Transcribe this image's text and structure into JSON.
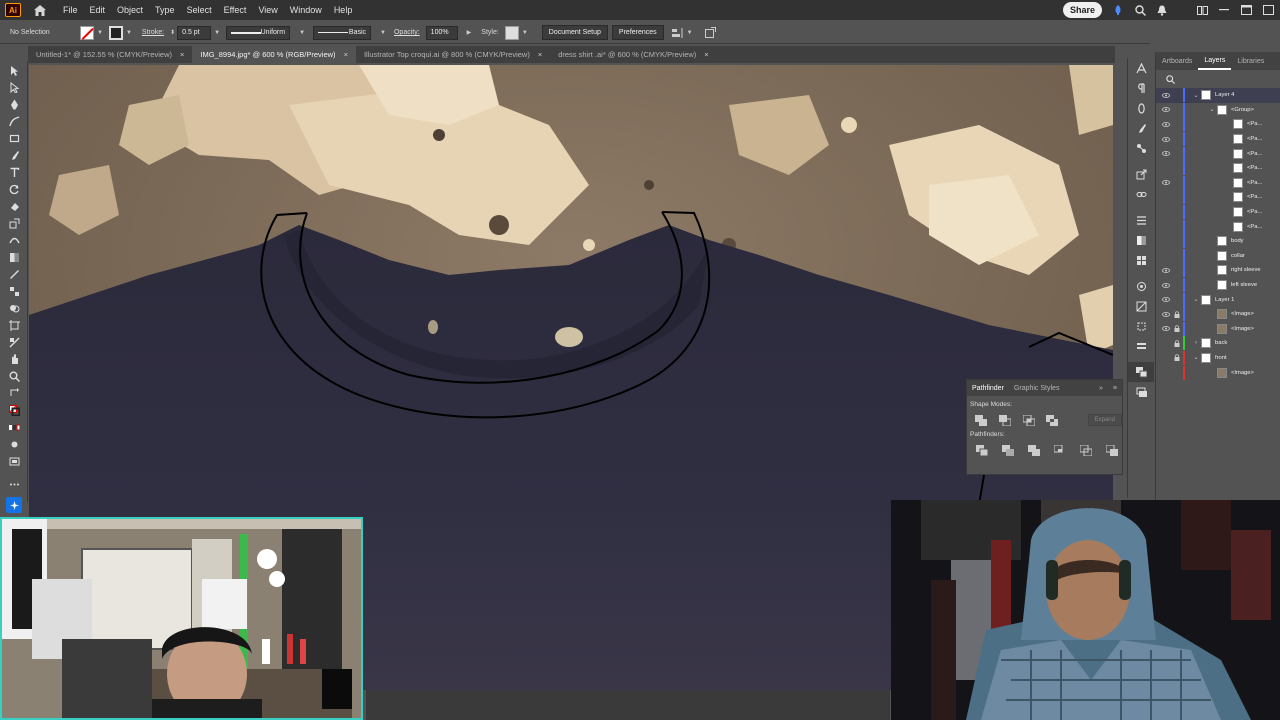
{
  "app": {
    "menus": [
      "File",
      "Edit",
      "Object",
      "Type",
      "Select",
      "Effect",
      "View",
      "Window",
      "Help"
    ],
    "share_label": "Share",
    "logo_text": "Ai"
  },
  "control_bar": {
    "selection": "No Selection",
    "stroke_label": "Stroke:",
    "stroke_value": "0.5 pt",
    "uniform_label": "Uniform",
    "basic_label": "Basic",
    "opacity_label": "Opacity:",
    "opacity_value": "100%",
    "style_label": "Style:",
    "document_setup": "Document Setup",
    "preferences": "Preferences"
  },
  "tabs": [
    {
      "label": "Untitled-1* @ 152.55 % (CMYK/Preview)",
      "active": false
    },
    {
      "label": "IMG_8994.jpg* @ 600 % (RGB/Preview)",
      "active": true
    },
    {
      "label": "Illustrator Top croqui.ai @ 800 % (CMYK/Preview)",
      "active": false
    },
    {
      "label": "dress shirt .ai* @ 600 % (CMYK/Preview)",
      "active": false
    }
  ],
  "layers_panel": {
    "tabs": [
      "Artboards",
      "Layers",
      "Libraries"
    ],
    "active_tab": "Layers",
    "rows": [
      {
        "name": "Layer 4",
        "indent": 0,
        "eye": true,
        "lock": false,
        "disc": "v",
        "color": "#4a6cff",
        "highlight": true
      },
      {
        "name": "<Group>",
        "indent": 1,
        "eye": true,
        "lock": false,
        "disc": "v",
        "color": "#4a6cff"
      },
      {
        "name": "<Pa...",
        "indent": 2,
        "eye": true,
        "lock": false,
        "disc": "",
        "color": "#4a6cff"
      },
      {
        "name": "<Pa...",
        "indent": 2,
        "eye": true,
        "lock": false,
        "disc": "",
        "color": "#4a6cff"
      },
      {
        "name": "<Pa...",
        "indent": 2,
        "eye": true,
        "lock": false,
        "disc": "",
        "color": "#4a6cff"
      },
      {
        "name": "<Pa...",
        "indent": 2,
        "eye": false,
        "lock": false,
        "disc": "",
        "color": "#4a6cff"
      },
      {
        "name": "<Pa...",
        "indent": 2,
        "eye": true,
        "lock": false,
        "disc": "",
        "color": "#4a6cff"
      },
      {
        "name": "<Pa...",
        "indent": 2,
        "eye": false,
        "lock": false,
        "disc": "",
        "color": "#4a6cff"
      },
      {
        "name": "<Pa...",
        "indent": 2,
        "eye": false,
        "lock": false,
        "disc": "",
        "color": "#4a6cff"
      },
      {
        "name": "<Pa...",
        "indent": 2,
        "eye": false,
        "lock": false,
        "disc": "",
        "color": "#4a6cff"
      },
      {
        "name": "body",
        "indent": 1,
        "eye": false,
        "lock": false,
        "disc": "",
        "color": "#4a6cff"
      },
      {
        "name": "collar",
        "indent": 1,
        "eye": false,
        "lock": false,
        "disc": "",
        "color": "#4a6cff"
      },
      {
        "name": "right sleeve",
        "indent": 1,
        "eye": true,
        "lock": false,
        "disc": "",
        "color": "#4a6cff"
      },
      {
        "name": "left sleeve",
        "indent": 1,
        "eye": true,
        "lock": false,
        "disc": "",
        "color": "#4a6cff"
      },
      {
        "name": "Layer 1",
        "indent": 0,
        "eye": true,
        "lock": false,
        "disc": "v",
        "color": "#4a6cff"
      },
      {
        "name": "<Image>",
        "indent": 1,
        "eye": true,
        "lock": true,
        "disc": "",
        "color": "#4a6cff"
      },
      {
        "name": "<Image>",
        "indent": 1,
        "eye": true,
        "lock": true,
        "disc": "",
        "color": "#4a6cff"
      },
      {
        "name": "back",
        "indent": 0,
        "eye": false,
        "lock": true,
        "disc": ">",
        "color": "#33cc33"
      },
      {
        "name": "front",
        "indent": 0,
        "eye": false,
        "lock": true,
        "disc": "v",
        "color": "#e03030"
      },
      {
        "name": "<Image>",
        "indent": 1,
        "eye": false,
        "lock": false,
        "disc": "",
        "color": "#e03030"
      }
    ]
  },
  "pathfinder": {
    "tabs": [
      "Pathfinder",
      "Graphic Styles"
    ],
    "shape_modes_label": "Shape Modes:",
    "pathfinders_label": "Pathfinders:",
    "expand_label": "Expand"
  },
  "icons": {
    "home": "home-icon",
    "search": "search-icon",
    "bell": "bell-icon",
    "rocket": "rocket-icon"
  }
}
